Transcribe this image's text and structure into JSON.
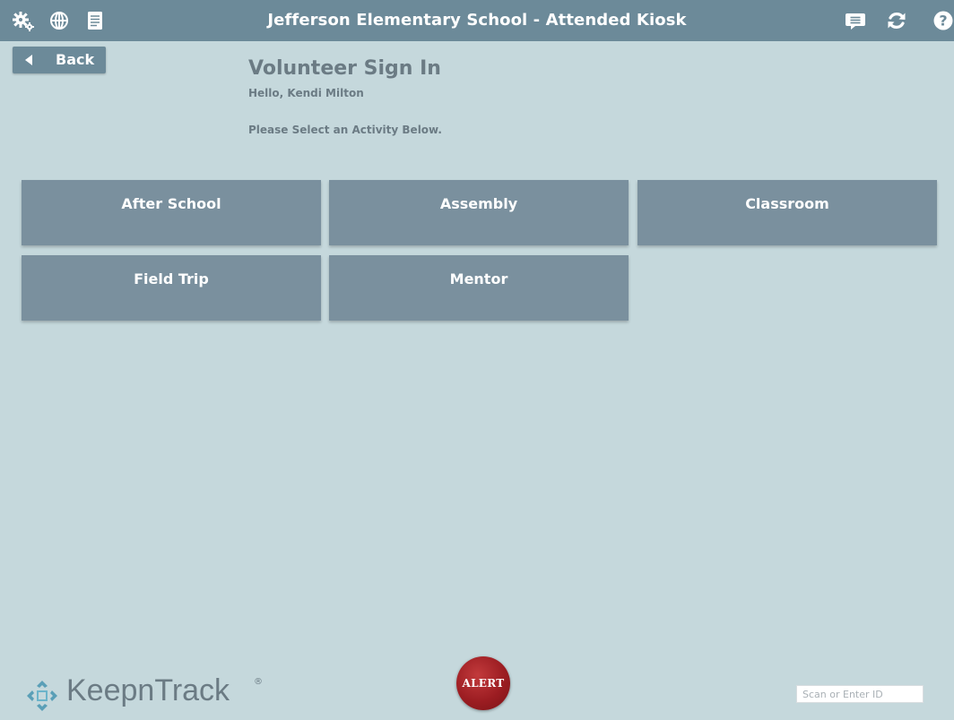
{
  "header": {
    "title": "Jefferson Elementary School - Attended Kiosk",
    "left_icons": [
      "gear-icon",
      "globe-icon",
      "document-icon"
    ],
    "right_icons": [
      "message-icon",
      "refresh-icon",
      "help-icon"
    ]
  },
  "back": {
    "label": "Back"
  },
  "page": {
    "title": "Volunteer Sign In",
    "greeting": "Hello, Kendi Milton",
    "instruction": "Please Select an Activity Below."
  },
  "activities": [
    "After School",
    "Assembly",
    "Classroom",
    "Field Trip",
    "Mentor"
  ],
  "footer": {
    "logo_text": "KeepnTrack",
    "logo_mark": "®",
    "alert_label": "ALERT",
    "scan_placeholder": "Scan or Enter ID"
  },
  "colors": {
    "background": "#c5d8dc",
    "header": "#6c8a99",
    "tile": "#7a909e",
    "alert": "#9c1d22"
  }
}
